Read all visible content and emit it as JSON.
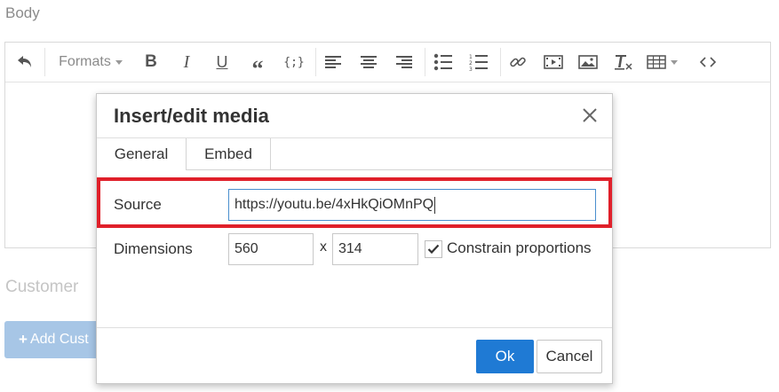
{
  "page": {
    "body_label": "Body",
    "customer_label": "Customer",
    "add_button_label": "Add Cust"
  },
  "toolbar": {
    "formats_label": "Formats",
    "icons": [
      "undo-icon",
      "bold-icon",
      "italic-icon",
      "underline-icon",
      "blockquote-icon",
      "code-icon",
      "align-left-icon",
      "align-center-icon",
      "align-right-icon",
      "bullet-list-icon",
      "numbered-list-icon",
      "link-icon",
      "media-icon",
      "image-icon",
      "clear-format-icon",
      "table-icon",
      "source-code-icon"
    ]
  },
  "dialog": {
    "title": "Insert/edit media",
    "tabs": [
      {
        "label": "General"
      },
      {
        "label": "Embed"
      }
    ],
    "source_label": "Source",
    "source_value": "https://youtu.be/4xHkQiOMnPQ",
    "dimensions_label": "Dimensions",
    "width_value": "560",
    "height_value": "314",
    "x_separator": "x",
    "constrain_label": "Constrain proportions",
    "constrain_checked": true,
    "ok_label": "Ok",
    "cancel_label": "Cancel"
  },
  "colors": {
    "accent": "#1f7ad4",
    "highlight": "#e0202a",
    "input_focus": "#4a8fce"
  }
}
